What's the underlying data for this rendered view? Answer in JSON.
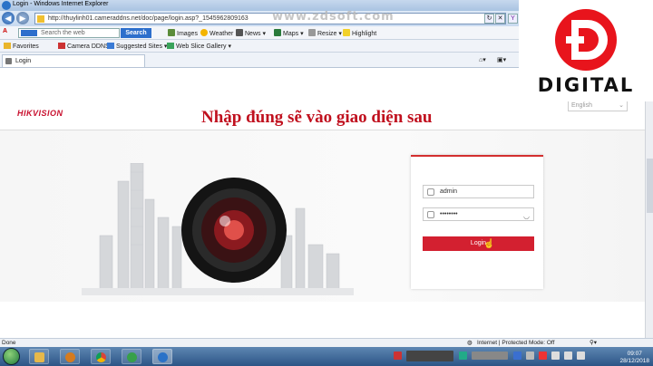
{
  "window": {
    "title": "Login - Windows Internet Explorer"
  },
  "address": {
    "url": "http://thuylinh01.cameraddns.net/doc/page/login.asp?_1545962809163"
  },
  "watermark": "www.zdsoft.com",
  "search": {
    "placeholder": "Search the web",
    "button": "Search"
  },
  "toolbar": {
    "images": "Images",
    "weather": "Weather",
    "news": "News",
    "maps": "Maps",
    "resize": "Resize",
    "highlight": "Highlight"
  },
  "favorites": {
    "label": "Favorites",
    "items": [
      "Camera DDNS",
      "Suggested Sites",
      "Web Slice Gallery"
    ]
  },
  "tab": {
    "title": "Login"
  },
  "page": {
    "brand": "HIKVISION",
    "language": "English",
    "overlay_text": "Nhập đúng sẽ vào giao diện sau",
    "username_value": "admin",
    "password_value": "••••••••",
    "login_button": "Login"
  },
  "logo": {
    "text": "DIGITAL",
    "color": "#e8141c"
  },
  "status": {
    "left": "Done",
    "zone": "Internet | Protected Mode: Off"
  },
  "clock": {
    "time": "09:07",
    "date": "28/12/2018"
  },
  "colors": {
    "accent": "#d32030",
    "overlay": "#c0101e"
  }
}
